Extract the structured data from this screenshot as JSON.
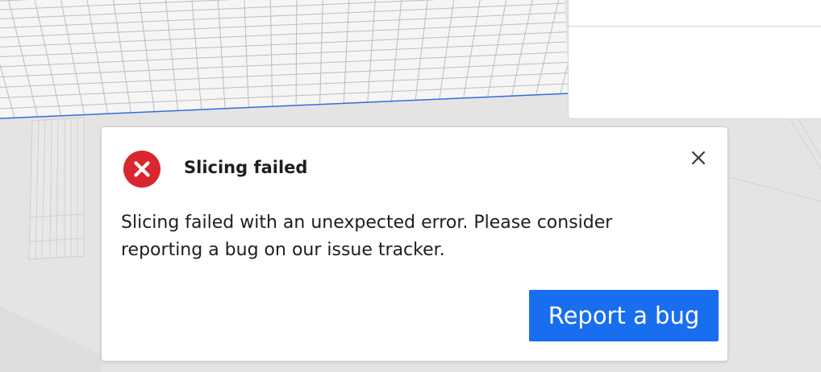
{
  "colors": {
    "accent": "#196ef0",
    "error": "#d9262f",
    "background": "#e4e4e4",
    "build_plate": "#f4f4f4",
    "grid_line": "#b8b8b8",
    "plate_edge": "#2f6fdc"
  },
  "notification": {
    "icon": "error-x-circle-icon",
    "title": "Slicing failed",
    "message": "Slicing failed with an unexpected error. Please consider reporting a bug on our issue tracker.",
    "close_icon": "close-icon",
    "action_label": "Report a bug"
  }
}
